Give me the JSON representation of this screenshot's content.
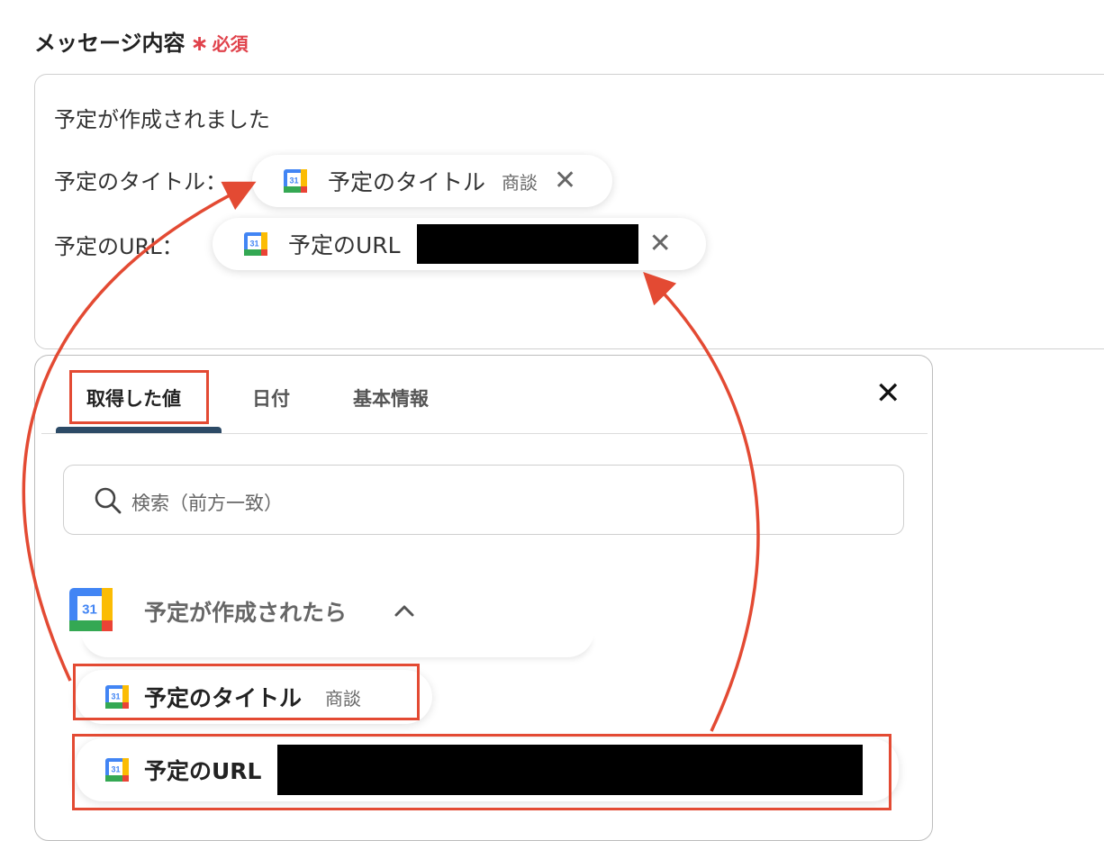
{
  "field": {
    "label": "メッセージ内容",
    "required_star": "∗",
    "required_text": "必須"
  },
  "message": {
    "line1": "予定が作成されました",
    "line2_prefix": "予定のタイトル：",
    "line3_prefix": "予定のURL："
  },
  "tokens": {
    "title": {
      "label": "予定のタイトル",
      "sample": "商談",
      "remove": "✕"
    },
    "url": {
      "label": "予定のURL",
      "remove": "✕"
    }
  },
  "panel": {
    "tabs": [
      {
        "label": "取得した値",
        "active": true
      },
      {
        "label": "日付",
        "active": false
      },
      {
        "label": "基本情報",
        "active": false
      }
    ],
    "close": "✕",
    "search_placeholder": "検索（前方一致）",
    "group": {
      "title": "予定が作成されたら",
      "items": [
        {
          "label": "予定のタイトル",
          "sample": "商談"
        },
        {
          "label": "予定のURL"
        }
      ]
    }
  },
  "icons": {
    "calendar": "google-calendar-icon",
    "calendar_day": "31",
    "search": "search-icon",
    "chevron": "chevron-up-icon"
  },
  "colors": {
    "required": "#e0424b",
    "highlight": "#e34a33",
    "tab_underline": "#2c4a66"
  }
}
